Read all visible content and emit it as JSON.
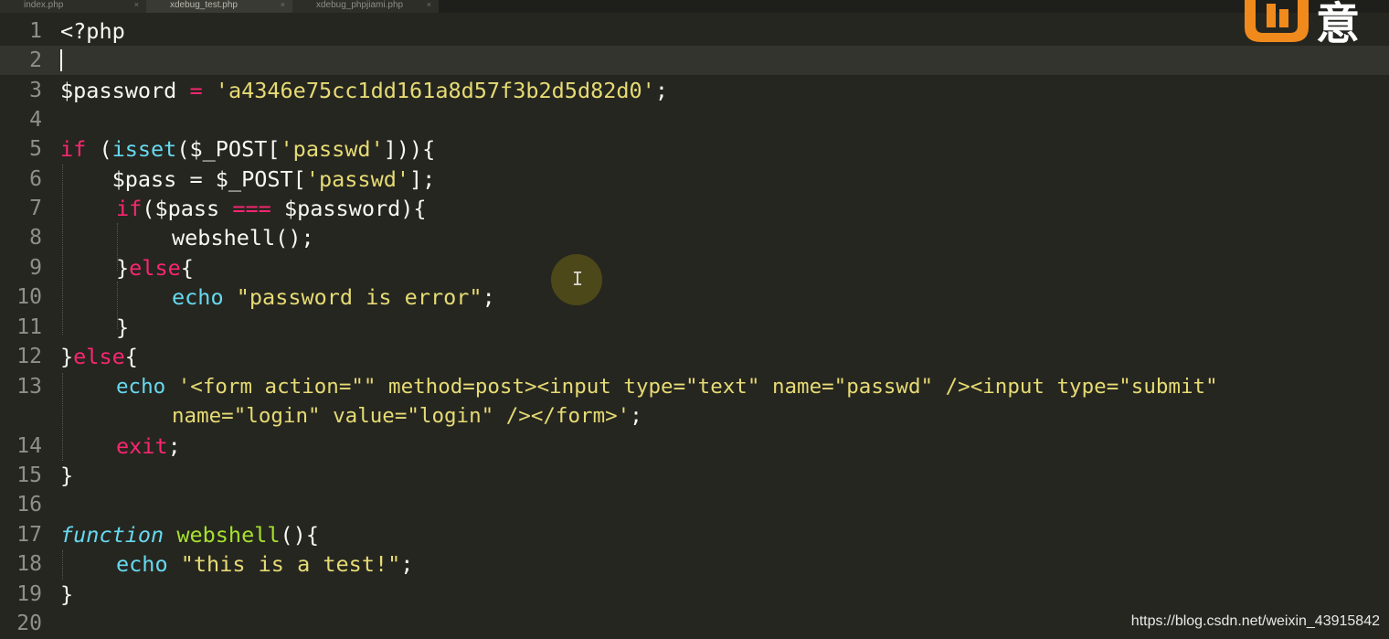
{
  "tabs": [
    {
      "label": "index.php",
      "close": "×"
    },
    {
      "label": "xdebug_test.php",
      "close": "×"
    },
    {
      "label": "xdebug_phpjiami.php",
      "close": "×"
    }
  ],
  "logo_text": "意",
  "gutter": [
    "1",
    "2",
    "3",
    "4",
    "5",
    "6",
    "7",
    "8",
    "9",
    "10",
    "11",
    "12",
    "13",
    "",
    "14",
    "15",
    "16",
    "17",
    "18",
    "19",
    "20"
  ],
  "code": {
    "l1": "<?php",
    "l3_var": "$password",
    "l3_eq": " = ",
    "l3_str": "'a4346e75cc1dd161a8d57f3b2d5d82d0'",
    "l3_end": ";",
    "l5_if": "if",
    "l5_a": " (",
    "l5_isset": "isset",
    "l5_b": "($_POST[",
    "l5_str": "'passwd'",
    "l5_c": "])){",
    "l6_a": "    $pass = $_POST[",
    "l6_str": "'passwd'",
    "l6_b": "];",
    "l7_if": "if",
    "l7_a": "($pass ",
    "l7_op": "===",
    "l7_b": " $password){",
    "l8": "webshell();",
    "l9_a": "}",
    "l9_else": "else",
    "l9_b": "{",
    "l10_echo": "echo",
    "l10_str": "\"password is error\"",
    "l10_end": ";",
    "l11": "}",
    "l12_a": "}",
    "l12_else": "else",
    "l12_b": "{",
    "l13_echo": "echo",
    "l13_str": "'<form action=\"\" method=post><input type=\"text\" name=\"passwd\" /><input type=\"submit\"",
    "l13w_str": "name=\"login\" value=\"login\" /></form>'",
    "l13w_end": ";",
    "l14_exit": "exit",
    "l14_end": ";",
    "l15": "}",
    "l17_function": "function",
    "l17_name": "webshell",
    "l17_end": "(){",
    "l18_echo": "echo",
    "l18_str": "\"this is a test!\"",
    "l18_end": ";",
    "l19": "}"
  },
  "watermark": "https://blog.csdn.net/weixin_43915842",
  "colors": {
    "background": "#262620",
    "keyword": "#f92672",
    "string": "#e6db74",
    "builtin": "#66d9ef",
    "function": "#a6e22e",
    "text": "#f8f8f2"
  }
}
